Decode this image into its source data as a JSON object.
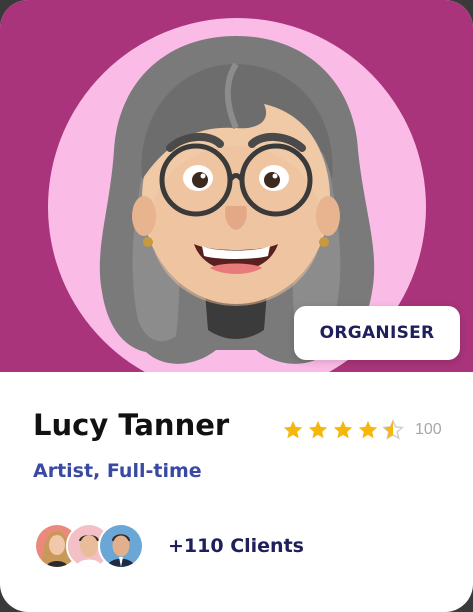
{
  "profile": {
    "name": "Lucy Tanner",
    "role": "Artist, Full-time",
    "badge_label": "ORGANISER",
    "rating": {
      "stars": 4.5,
      "max_stars": 5,
      "count": "100"
    },
    "clients_label": "+110 Clients"
  },
  "colors": {
    "hero_background": "#a9347b",
    "hero_circle": "#fbbbe7",
    "star_filled": "#f5b70d",
    "star_empty": "#cfcfcf",
    "name": "#111111",
    "role": "#3a4aa4",
    "badge_text": "#1e1f5b"
  },
  "icons": {
    "star": "star-icon",
    "avatar": "memoji-avatar"
  }
}
